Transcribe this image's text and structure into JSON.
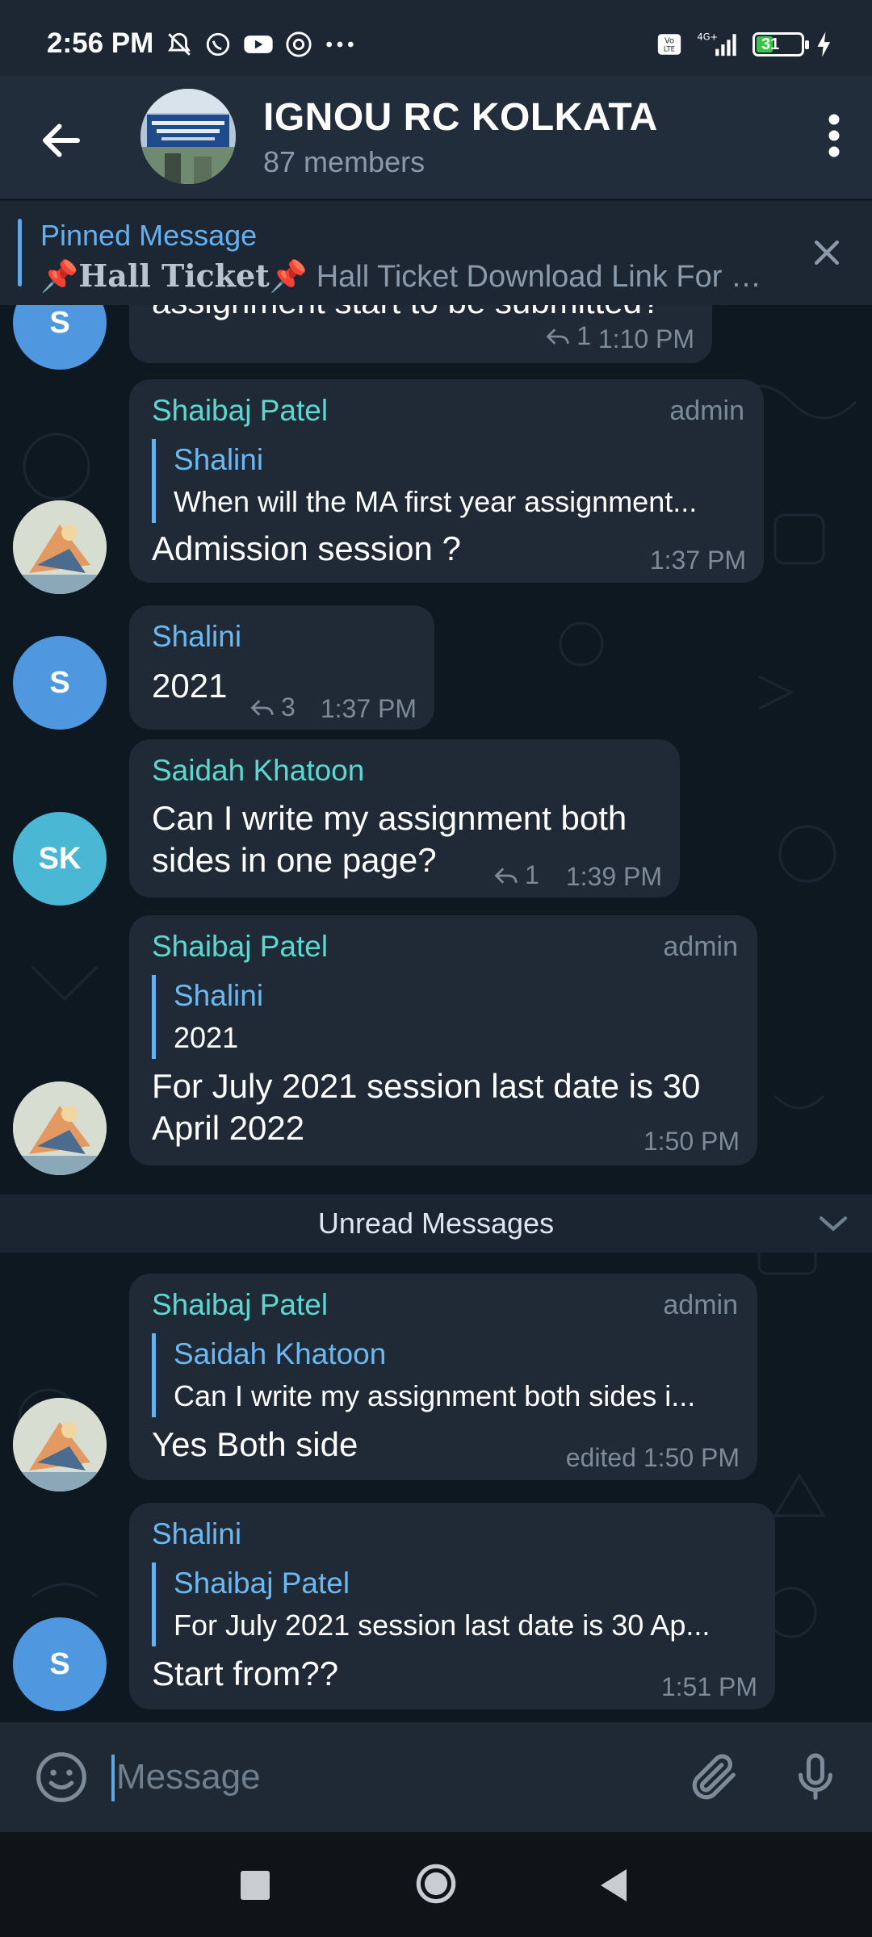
{
  "status_bar": {
    "time": "2:56 PM",
    "network": "4G+",
    "volte": "Vo LTE",
    "battery": "31"
  },
  "header": {
    "title": "IGNOU RC KOLKATA",
    "subtitle": "87 members"
  },
  "pinned": {
    "label": "Pinned Message",
    "bold_part": "📌Hall Ticket📌",
    "text": " Hall Ticket Download Link For Dec..."
  },
  "messages": [
    {
      "partial_text": "assignment start to be submitted?",
      "avatar_initials": "S",
      "replies": "1",
      "time": "1:10 PM"
    },
    {
      "sender": "Shaibaj Patel",
      "role": "admin",
      "reply_to": "Shalini",
      "reply_text": "When will the MA first year assignment...",
      "text": "Admission session ?",
      "time": "1:37 PM"
    },
    {
      "sender": "Shalini",
      "text": "2021",
      "replies": "3",
      "time": "1:37 PM",
      "avatar_initials": "S"
    },
    {
      "sender": "Saidah Khatoon",
      "text_line1": "Can I write my assignment both",
      "text_line2": "sides in one page?",
      "replies": "1",
      "time": "1:39 PM",
      "avatar_initials": "SK"
    },
    {
      "sender": "Shaibaj Patel",
      "role": "admin",
      "reply_to": "Shalini",
      "reply_text": "2021",
      "text_line1": "For July 2021 session last date is 30",
      "text_line2": "April 2022",
      "time": "1:50 PM"
    },
    {
      "sender": "Shaibaj Patel",
      "role": "admin",
      "reply_to": "Saidah Khatoon",
      "reply_text": "Can I write my assignment both sides i...",
      "text": "Yes Both side",
      "time": "edited 1:50 PM"
    },
    {
      "sender": "Shalini",
      "reply_to": "Shaibaj Patel",
      "reply_text": "For July 2021 session last date is 30 Ap...",
      "text": "Start from??",
      "time": "1:51 PM",
      "avatar_initials": "S"
    }
  ],
  "unread_label": "Unread Messages",
  "composer": {
    "placeholder": "Message"
  },
  "colors": {
    "accent": "#64b0f0",
    "name_teal": "#5bd8d0",
    "bubble": "#1f2a36",
    "header": "#212d3b"
  }
}
